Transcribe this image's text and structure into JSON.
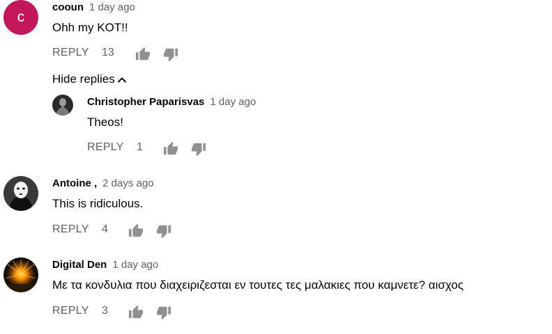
{
  "comments": [
    {
      "avatar_letter": "c",
      "avatar_color": "#c2185b",
      "author": "cooun",
      "time": "1 day ago",
      "text": "Ohh my KOT!!",
      "reply_label": "REPLY",
      "likes": "13",
      "toggle_replies_label": "Hide replies",
      "replies": [
        {
          "author": "Christopher Paparisvas",
          "time": "1 day ago",
          "text": "Theos!",
          "reply_label": "REPLY",
          "likes": "1"
        }
      ]
    },
    {
      "author": "Antoine ,",
      "time": "2 days ago",
      "text": "This is ridiculous.",
      "reply_label": "REPLY",
      "likes": "4"
    },
    {
      "author": "Digital Den",
      "time": "1 day ago",
      "text": "Με τα κονδυλια που διαχειριζεσται εν τουτες τες μαλακιες που καμνετε? αισχος",
      "reply_label": "REPLY",
      "likes": "3"
    }
  ],
  "icons": {
    "like": "thumb-up-icon",
    "dislike": "thumb-down-icon",
    "chevron": "chevron-up-icon"
  },
  "colors": {
    "text_primary": "#030303",
    "text_secondary": "#606060",
    "icon": "#909090"
  }
}
